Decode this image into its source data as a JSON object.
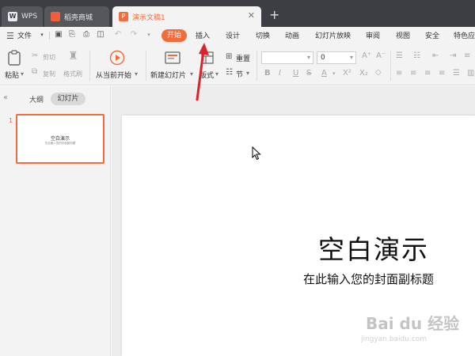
{
  "tabs": {
    "wps": "WPS",
    "store": "稻壳商城",
    "doc": "演示文稿1"
  },
  "menu": {
    "file": "文件",
    "start": "开始",
    "insert": "插入",
    "design": "设计",
    "transition": "切换",
    "animation": "动画",
    "slideshow": "幻灯片放映",
    "review": "审阅",
    "view": "视图",
    "security": "安全",
    "special": "特色应"
  },
  "ribbon": {
    "paste": "粘贴",
    "cut": "剪切",
    "copy": "复制",
    "format_painter": "格式刷",
    "from_current": "从当前开始",
    "new_slide": "新建幻灯片",
    "layout": "版式",
    "reset": "重置",
    "section": "节",
    "font_size": "0"
  },
  "panel": {
    "outline": "大纲",
    "slides": "幻灯片",
    "slide_number": "1",
    "thumb_title": "空白演示",
    "thumb_sub": "在此输入您的封面副标题"
  },
  "slide": {
    "title": "空白演示",
    "subtitle": "在此输入您的封面副标题"
  },
  "watermark": {
    "brand": "Bai du 经验",
    "url": "jingyan.baidu.com"
  },
  "colors": {
    "accent": "#f26b3a",
    "titlebar": "#3c3e44",
    "annotation_arrow": "#d9232d"
  }
}
